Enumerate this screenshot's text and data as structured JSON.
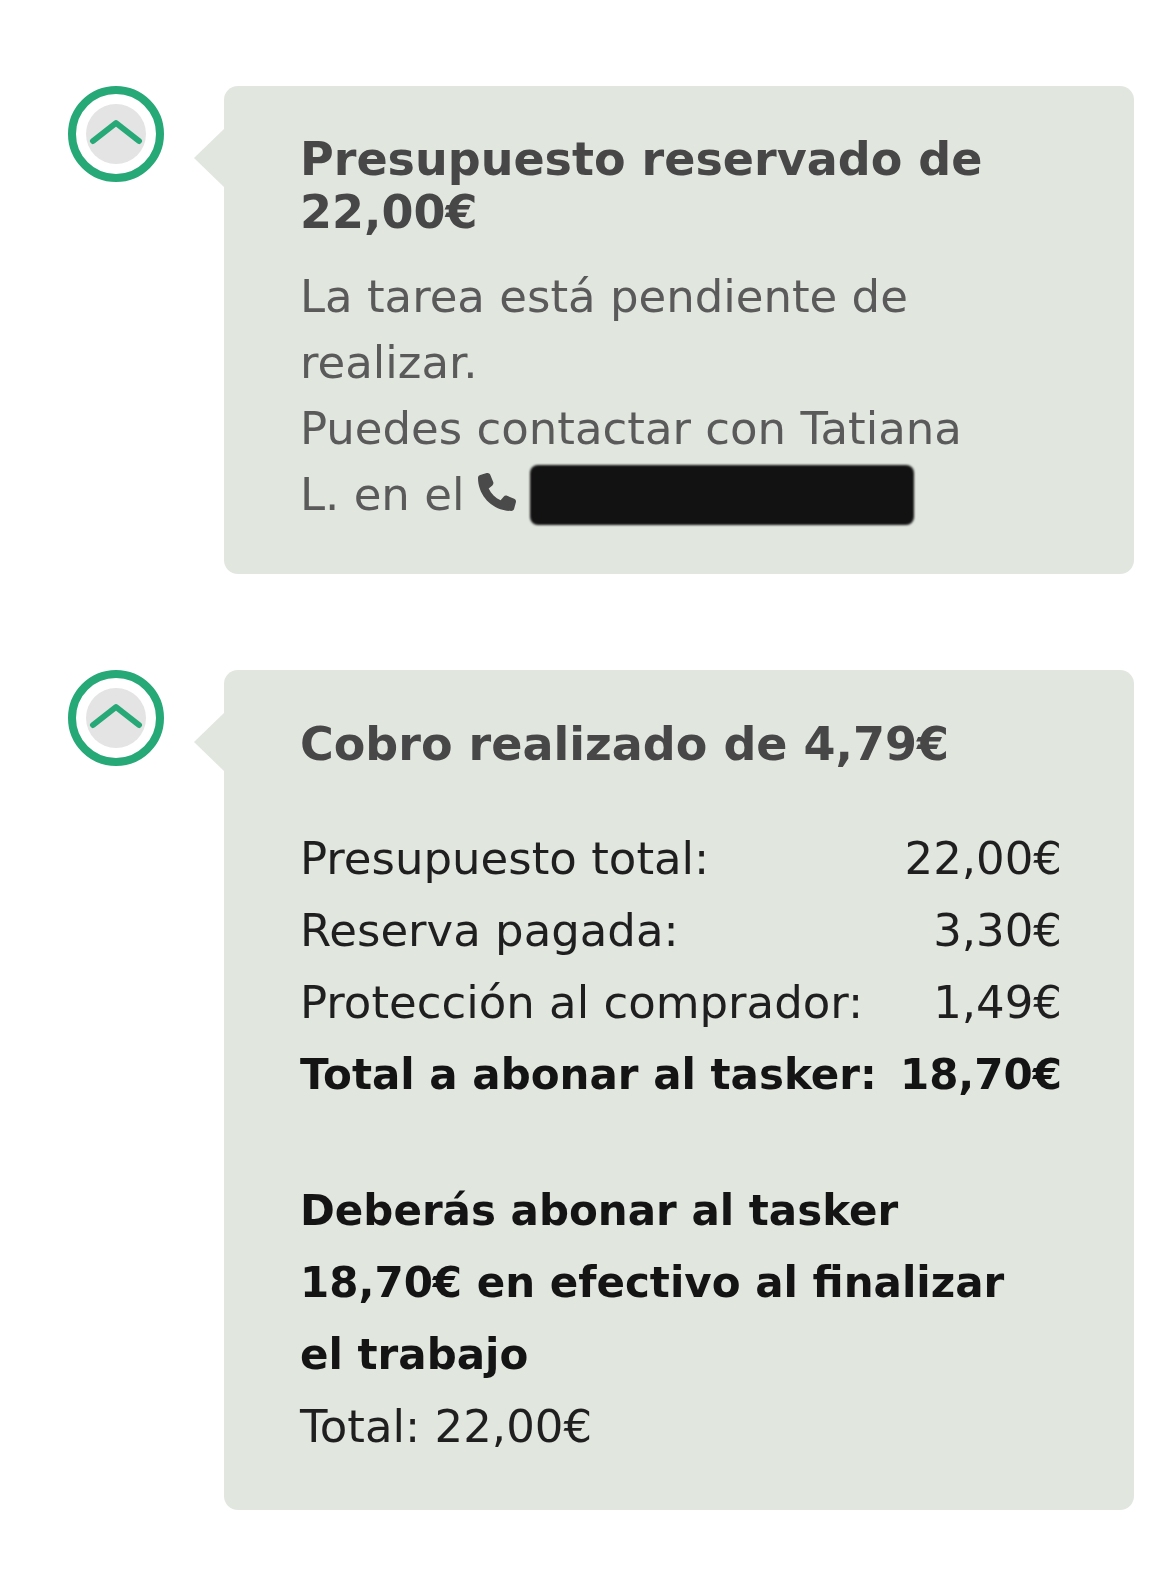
{
  "cards": [
    {
      "expanded": true,
      "title": "Presupuesto reservado de 22,00€",
      "lines": [
        {
          "kind": "text",
          "text": "La tarea está pendiente de realizar."
        },
        {
          "kind": "text",
          "text": "Puedes contactar con Tatiana"
        },
        {
          "kind": "contact",
          "text": "L. en el"
        }
      ]
    },
    {
      "expanded": true,
      "title": "Cobro realizado de 4,79€",
      "breakdown": [
        {
          "kind": "item",
          "label": "Presupuesto total:",
          "value": "22,00€"
        },
        {
          "kind": "item",
          "label": "Reserva pagada:",
          "value": "3,30€"
        },
        {
          "kind": "item",
          "label": "Protección al comprador:",
          "value": "1,49€"
        },
        {
          "kind": "total",
          "label": "Total a abonar al tasker:",
          "value": "18,70€"
        }
      ],
      "notice": "Deberás abonar al tasker 18,70€ en efectivo al finalizar el trabajo",
      "footer": "Total: 22,00€"
    }
  ]
}
